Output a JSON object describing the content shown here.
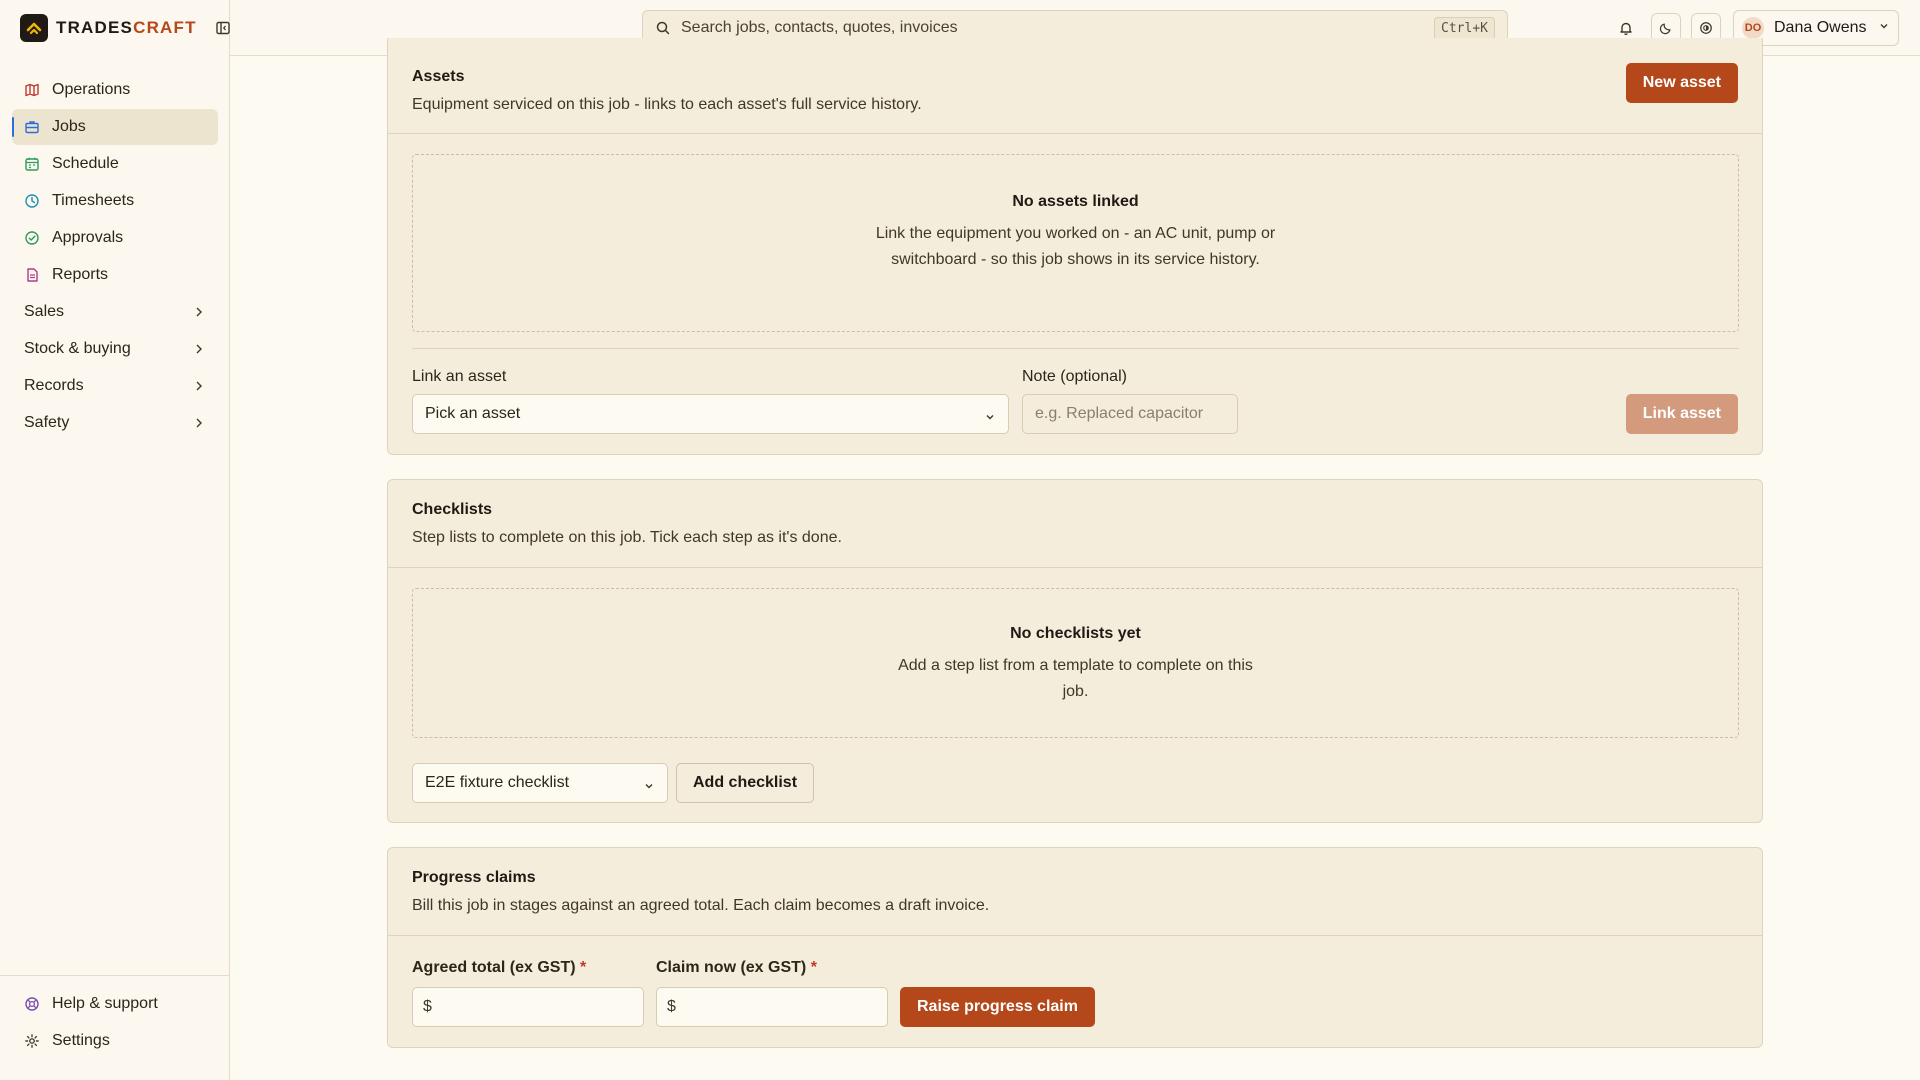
{
  "brand": {
    "name_prefix": "TRADES",
    "name_suffix": "CRAFT",
    "logo_color": "#1f1a14",
    "accent": "#b5481b"
  },
  "sidebar": {
    "items": [
      {
        "label": "Operations",
        "icon": "map-icon",
        "color": "#c0392b"
      },
      {
        "label": "Jobs",
        "icon": "briefcase-icon",
        "color": "#2b6fd6",
        "active": true
      },
      {
        "label": "Schedule",
        "icon": "calendar-icon",
        "color": "#2e9b5a"
      },
      {
        "label": "Timesheets",
        "icon": "clock-icon",
        "color": "#1f8fb3"
      },
      {
        "label": "Approvals",
        "icon": "check-circle-icon",
        "color": "#2e9b5a"
      },
      {
        "label": "Reports",
        "icon": "file-text-icon",
        "color": "#b03d8a"
      }
    ],
    "groups": [
      {
        "label": "Sales"
      },
      {
        "label": "Stock & buying"
      },
      {
        "label": "Records"
      },
      {
        "label": "Safety"
      }
    ],
    "bottom": [
      {
        "label": "Help & support",
        "icon": "help-circle-icon",
        "color": "#7a4fb0"
      },
      {
        "label": "Settings",
        "icon": "gear-icon",
        "color": "#4a4133"
      }
    ]
  },
  "topbar": {
    "search_placeholder": "Search jobs, contacts, quotes, invoices",
    "shortcut": "Ctrl+K",
    "user_initials": "DO",
    "user_name": "Dana Owens"
  },
  "assets": {
    "title": "Assets",
    "subtitle": "Equipment serviced on this job - links to each asset's full service history.",
    "new_button": "New asset",
    "empty_title": "No assets linked",
    "empty_text": "Link the equipment you worked on - an AC unit, pump or switchboard - so this job shows in its service history.",
    "link_label": "Link an asset",
    "link_select": "Pick an asset",
    "note_label": "Note (optional)",
    "note_placeholder": "e.g. Replaced capacitor",
    "link_button": "Link asset"
  },
  "checklists": {
    "title": "Checklists",
    "subtitle": "Step lists to complete on this job. Tick each step as it's done.",
    "empty_title": "No checklists yet",
    "empty_text": "Add a step list from a template to complete on this job.",
    "template_select": "E2E fixture checklist",
    "add_button": "Add checklist"
  },
  "progress": {
    "title": "Progress claims",
    "subtitle": "Bill this job in stages against an agreed total. Each claim becomes a draft invoice.",
    "agreed_label": "Agreed total (ex GST)",
    "claim_label": "Claim now (ex GST)",
    "required_mark": "*",
    "currency": "$",
    "raise_button": "Raise progress claim"
  }
}
